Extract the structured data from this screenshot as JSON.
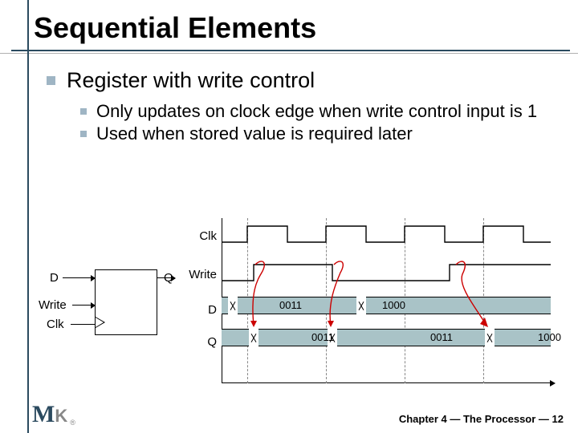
{
  "title": "Sequential Elements",
  "bullets": {
    "lvl1": "Register with write control",
    "lvl2a": "Only updates on clock edge when write control input is 1",
    "lvl2b": "Used when stored value is required later"
  },
  "register": {
    "d": "D",
    "q": "Q",
    "write": "Write",
    "clk": "Clk"
  },
  "timing": {
    "rows": {
      "clk": "Clk",
      "write": "Write",
      "d": "D",
      "q": "Q"
    },
    "d_values": [
      "0011",
      "1000"
    ],
    "q_values": [
      "0011",
      "0011",
      "1000"
    ]
  },
  "footer": {
    "chapter": "Chapter 4 — The Processor — 12"
  },
  "logo": {
    "m": "M",
    "k": "K",
    "reg": "®"
  }
}
